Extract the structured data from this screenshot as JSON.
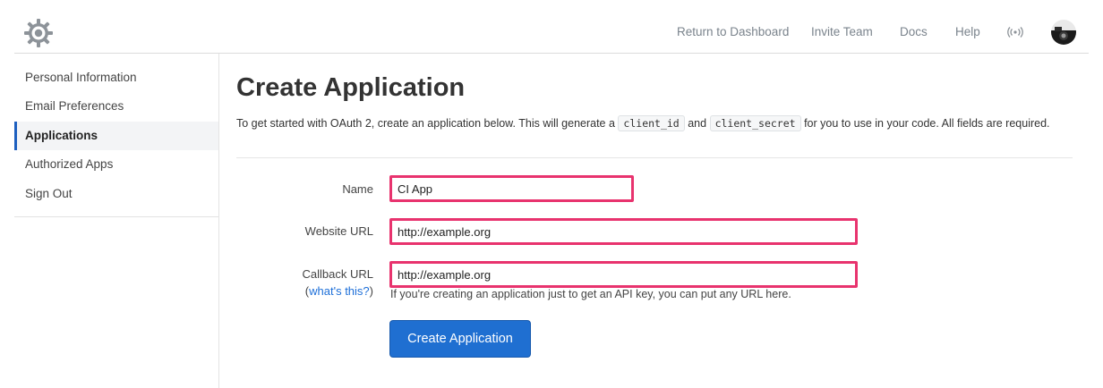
{
  "header": {
    "nav": [
      "Return to Dashboard",
      "Invite Team",
      "Docs",
      "Help"
    ]
  },
  "sidebar": {
    "items": [
      {
        "label": "Personal Information",
        "active": false
      },
      {
        "label": "Email Preferences",
        "active": false
      },
      {
        "label": "Applications",
        "active": true
      },
      {
        "label": "Authorized Apps",
        "active": false
      },
      {
        "label": "Sign Out",
        "active": false
      }
    ]
  },
  "main": {
    "title": "Create Application",
    "intro": {
      "before": "To get started with OAuth 2, create an application below. This will generate a",
      "code1": "client_id",
      "and": "and",
      "code2": "client_secret",
      "after": "for you to use in your code. All fields are required."
    },
    "form": {
      "name_label": "Name",
      "name_value": "CI App",
      "website_label": "Website URL",
      "website_value": "http://example.org",
      "callback_label": "Callback URL",
      "callback_help_open": "(",
      "callback_help_link": "what's this?",
      "callback_help_close": ")",
      "callback_value": "http://example.org",
      "callback_hint": "If you're creating an application just to get an API key, you can put any URL here.",
      "submit_label": "Create Application"
    }
  },
  "colors": {
    "accent": "#1f6fd1",
    "highlight_border": "#e8336e",
    "link": "#1d6fd8"
  }
}
